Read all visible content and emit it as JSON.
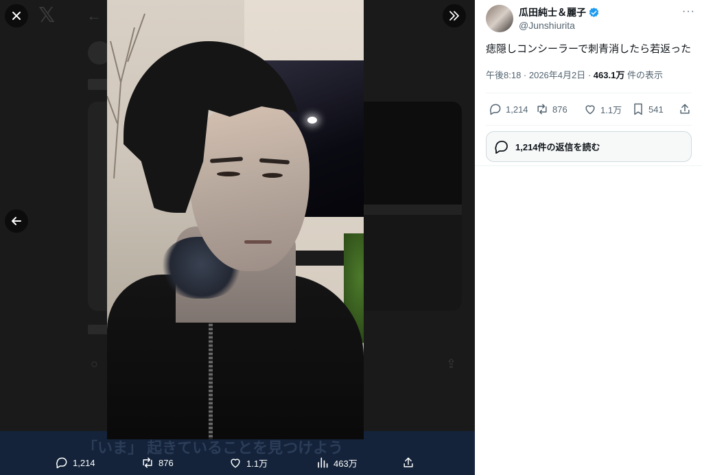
{
  "viewer": {
    "close_label": "×",
    "logo_label": "𝕏",
    "expand_label": "»",
    "prev_label": "←",
    "background_banner_text": "「いま」 起きていることを見つけよう"
  },
  "media_actions": {
    "replies": "1,214",
    "reposts": "876",
    "likes": "1.1万",
    "views": "463万"
  },
  "tweet": {
    "author_name": "瓜田純士＆麗子",
    "handle": "@Junshiurita",
    "more_label": "···",
    "text": "痣隠しコンシーラーで刺青消したら若返った",
    "time": "午後8:18 · 2026年4月2日 · ",
    "views": "463.1万",
    "views_label": " 件の表示",
    "replies": "1,214",
    "reposts": "876",
    "likes": "1.1万",
    "bookmarks": "541",
    "read_replies": "1,214件の返信を読む"
  },
  "colors": {
    "verified": "#1d9bf0",
    "text_primary": "#0f1419",
    "text_secondary": "#536471",
    "banner": "#14233a"
  },
  "icons": [
    "close-icon",
    "x-logo-icon",
    "expand-icon",
    "arrow-left-icon",
    "reply-icon",
    "repost-icon",
    "like-icon",
    "views-icon",
    "share-icon",
    "bookmark-icon",
    "verified-icon",
    "more-icon"
  ]
}
